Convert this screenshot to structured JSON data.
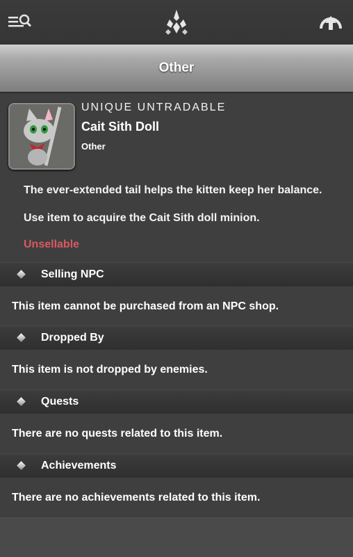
{
  "topbar": {
    "menu_icon": "menu-search-icon",
    "logo_icon": "crystal-logo-icon",
    "up_icon": "home-up-icon"
  },
  "page": {
    "title": "Other"
  },
  "item": {
    "rarity": "UNIQUE UNTRADABLE",
    "name": "Cait Sith Doll",
    "type": "Other",
    "description": "The ever-extended tail helps the kitten keep her balance.",
    "usage": "Use item to acquire the Cait Sith doll minion.",
    "sell_status": "Unsellable",
    "colors": {
      "unsellable": "#d9595f"
    }
  },
  "sections": [
    {
      "title": "Selling NPC",
      "body": "This item cannot be purchased from an NPC shop."
    },
    {
      "title": "Dropped By",
      "body": "This item is not dropped by enemies."
    },
    {
      "title": "Quests",
      "body": "There are no quests related to this item."
    },
    {
      "title": "Achievements",
      "body": "There are no achievements related to this item."
    }
  ]
}
